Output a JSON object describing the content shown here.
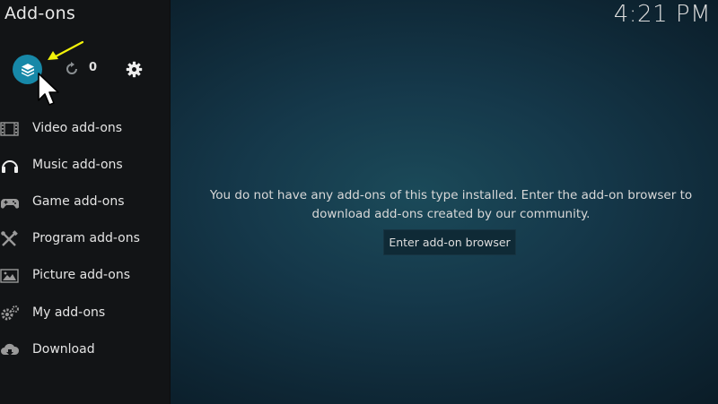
{
  "header": {
    "title": "Add-ons",
    "clock": "4:21 PM"
  },
  "toolbar": {
    "update_count": "0"
  },
  "sidebar": {
    "items": [
      {
        "label": "Video add-ons",
        "icon": "film-icon"
      },
      {
        "label": "Music add-ons",
        "icon": "headphones-icon"
      },
      {
        "label": "Game add-ons",
        "icon": "gamepad-icon"
      },
      {
        "label": "Program add-ons",
        "icon": "tools-icon"
      },
      {
        "label": "Picture add-ons",
        "icon": "picture-icon"
      },
      {
        "label": "My add-ons",
        "icon": "gears-icon"
      },
      {
        "label": "Download",
        "icon": "cloud-download-icon"
      }
    ]
  },
  "main": {
    "message": "You do not have any add-ons of this type installed. Enter the add-on browser to download add-ons created by our community.",
    "button_label": "Enter add-on browser"
  },
  "colors": {
    "accent": "#1788a8",
    "sidebar_bg": "#121416",
    "annotation_arrow": "#f2f20a"
  }
}
